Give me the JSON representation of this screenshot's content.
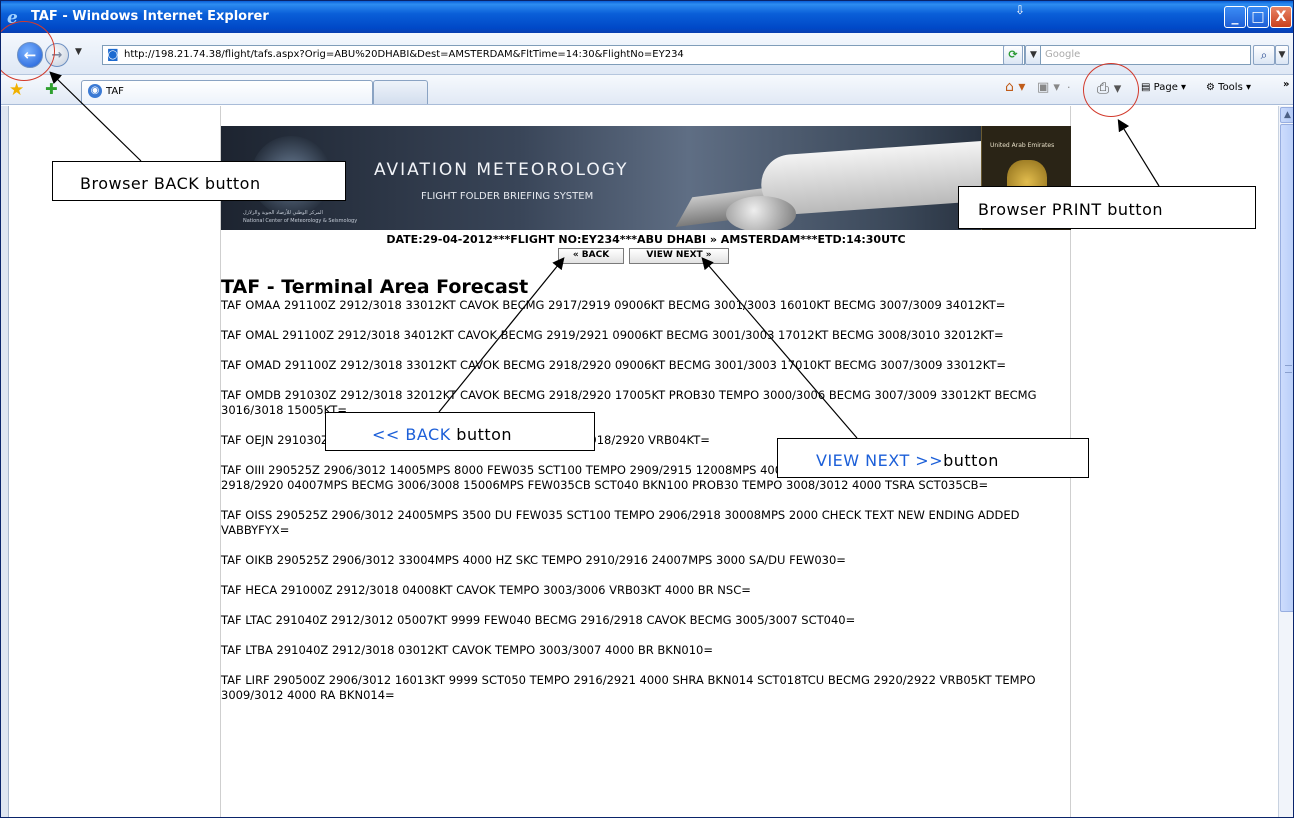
{
  "window": {
    "title": "TAF - Windows Internet Explorer",
    "minimize_glyph": "_",
    "maximize_glyph": "□",
    "close_glyph": "X"
  },
  "address_bar": {
    "url": "http://198.21.74.38/flight/tafs.aspx?Orig=ABU%20DHABI&Dest=AMSTERDAM&FltTime=14:30&FlightNo=EY234",
    "search_placeholder": "Google"
  },
  "command_bar": {
    "tab_label": "TAF",
    "page_menu": "Page ▾",
    "tools_menu": "Tools ▾"
  },
  "banner": {
    "title": "AVIATION METEOROLOGY",
    "subtitle": "FLIGHT FOLDER BRIEFING SYSTEM",
    "emblem_label": "United Arab Emirates",
    "arabic_caption": "المركز الوطني للأرصاد الجوية والزلازل",
    "ncms_caption": "National Center of Meteorology & Seismology"
  },
  "flight_info": "DATE:29-04-2012***FLIGHT NO:EY234***ABU DHABI » AMSTERDAM***ETD:14:30UTC",
  "page_buttons": {
    "back": "« BACK",
    "next": "VIEW NEXT »"
  },
  "heading": "TAF - Terminal Area Forecast",
  "tafs": [
    "TAF OMAA 291100Z 2912/3018 33012KT CAVOK BECMG 2917/2919 09006KT BECMG 3001/3003 16010KT BECMG 3007/3009 34012KT=",
    "TAF OMAL 291100Z 2912/3018 34012KT CAVOK BECMG 2919/2921 09006KT BECMG 3001/3003 17012KT BECMG 3008/3010 32012KT=",
    "TAF OMAD 291100Z 2912/3018 33012KT CAVOK BECMG 2918/2920 09006KT BECMG 3001/3003 17010KT BECMG 3007/3009 33012KT=",
    "TAF OMDB 291030Z 2912/3018 32012KT CAVOK BECMG 2918/2920 17005KT PROB30 TEMPO 3000/3006 BECMG 3007/3009 33012KT BECMG 3016/3018 15005KT=",
    "TAF OEJN 291030Z 2912/3018 27014KT 9999 FEW040 BECMG 2918/2920 VRB04KT=",
    "TAF OIII 290525Z 2906/3012 14005MPS 8000 FEW035 SCT100 TEMPO 2909/2915 12008MPS 4000 TSRA SCT035CB SCT040 BKN100 BECMG 2918/2920 04007MPS BECMG 3006/3008 15006MPS FEW035CB SCT040 BKN100 PROB30 TEMPO 3008/3012 4000 TSRA SCT035CB=",
    "TAF OISS 290525Z 2906/3012 24005MPS 3500 DU FEW035 SCT100 TEMPO 2906/2918 30008MPS 2000 CHECK TEXT NEW ENDING ADDED VABBYFYX=",
    "TAF OIKB 290525Z 2906/3012 33004MPS 4000 HZ SKC TEMPO 2910/2916 24007MPS 3000 SA/DU FEW030=",
    "TAF HECA 291000Z 2912/3018 04008KT CAVOK TEMPO 3003/3006 VRB03KT 4000 BR NSC=",
    "TAF LTAC 291040Z 2912/3012 05007KT 9999 FEW040 BECMG 2916/2918 CAVOK BECMG 3005/3007 SCT040=",
    "TAF LTBA 291040Z 2912/3018 03012KT CAVOK TEMPO 3003/3007 4000 BR BKN010=",
    "TAF LIRF 290500Z 2906/3012 16013KT 9999 SCT050 TEMPO 2916/2921 4000 SHRA BKN014 SCT018TCU BECMG 2920/2922 VRB05KT TEMPO 3009/3012 4000 RA BKN014="
  ],
  "annotations": {
    "browser_back": "Browser BACK button",
    "browser_print": "Browser PRINT button",
    "page_back_prefix": "<< BACK",
    "page_back_suffix": " button",
    "view_next_prefix": "VIEW NEXT >>",
    "view_next_suffix": "button"
  },
  "icons": {
    "back": "back-arrow-icon",
    "forward": "forward-arrow-icon",
    "refresh": "refresh-icon",
    "search": "search-icon",
    "favorites": "favorites-star-icon",
    "home": "home-icon",
    "feeds": "feeds-icon",
    "print": "printer-icon",
    "page": "page-icon",
    "tools": "gear-icon"
  },
  "colors": {
    "titlebar": "#0a5fd8",
    "annotation_ring": "#d23a2c",
    "annotation_blue": "#1c5fd8"
  }
}
